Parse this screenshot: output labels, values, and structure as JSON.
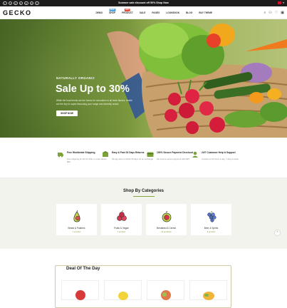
{
  "topbar": {
    "promo": "Summer sale discount off 50% Shop Now",
    "socials": [
      "f",
      "t",
      "in",
      "p",
      "ig",
      "yt",
      "v"
    ],
    "flag_color": "#c8102e"
  },
  "header": {
    "logo": "GECKO",
    "nav": [
      {
        "label": "DEMO",
        "badge": ""
      },
      {
        "label": "SHOP",
        "badge": "NEW",
        "badge_color": "#4aa3df"
      },
      {
        "label": "PRODUCT",
        "badge": "HOT",
        "badge_color": "#e84b3c"
      },
      {
        "label": "SALE",
        "badge": ""
      },
      {
        "label": "PAGES",
        "badge": ""
      },
      {
        "label": "LOOKBOOK",
        "badge": ""
      },
      {
        "label": "BLOG",
        "badge": ""
      },
      {
        "label": "BUY THEME",
        "badge": ""
      }
    ],
    "icons": [
      "search-icon",
      "account-icon",
      "wishlist-icon",
      "cart-icon"
    ],
    "cart_count": "0"
  },
  "hero": {
    "kicker": "NATURALLY ORGANIC",
    "title": "Sale Up to 30%",
    "description": "While the food trends are the forces for innovation in all fresh flavors, health are the key to super-flavouring your range and diversity snack.",
    "button": "SHOP NOW"
  },
  "features": [
    {
      "title": "Free Worldwide Shipping",
      "desc": "Free shipping for all US order or order above $99",
      "icon": "truck-icon"
    },
    {
      "title": "Easy & Fast 30 Days Returns",
      "desc": "Simply return it within 30 days for an exchange",
      "icon": "returns-icon"
    },
    {
      "title": "100% Secure Payment Checkout",
      "desc": "We ensure secure payment with PEV",
      "icon": "secure-payment-icon"
    },
    {
      "title": "24/7 Customer Help & Support",
      "desc": "Contact us 24 hours a day, 7 days a week",
      "icon": "support-icon"
    }
  ],
  "categories": {
    "title": "Shop By Categories",
    "accent": "#83a63f",
    "items": [
      {
        "name": "Bread & Pastries",
        "count": "7 product",
        "icon": "pear-icon"
      },
      {
        "name": "Fruits & Vegan",
        "count": "7 product",
        "icon": "berries-icon"
      },
      {
        "name": "Breakfast & Cereal",
        "count": "11 products",
        "icon": "pomegranate-icon"
      },
      {
        "name": "Beer & Spirits",
        "count": "3 product",
        "icon": "grapes-icon"
      }
    ]
  },
  "deal": {
    "title": "Deal Of The Day"
  }
}
